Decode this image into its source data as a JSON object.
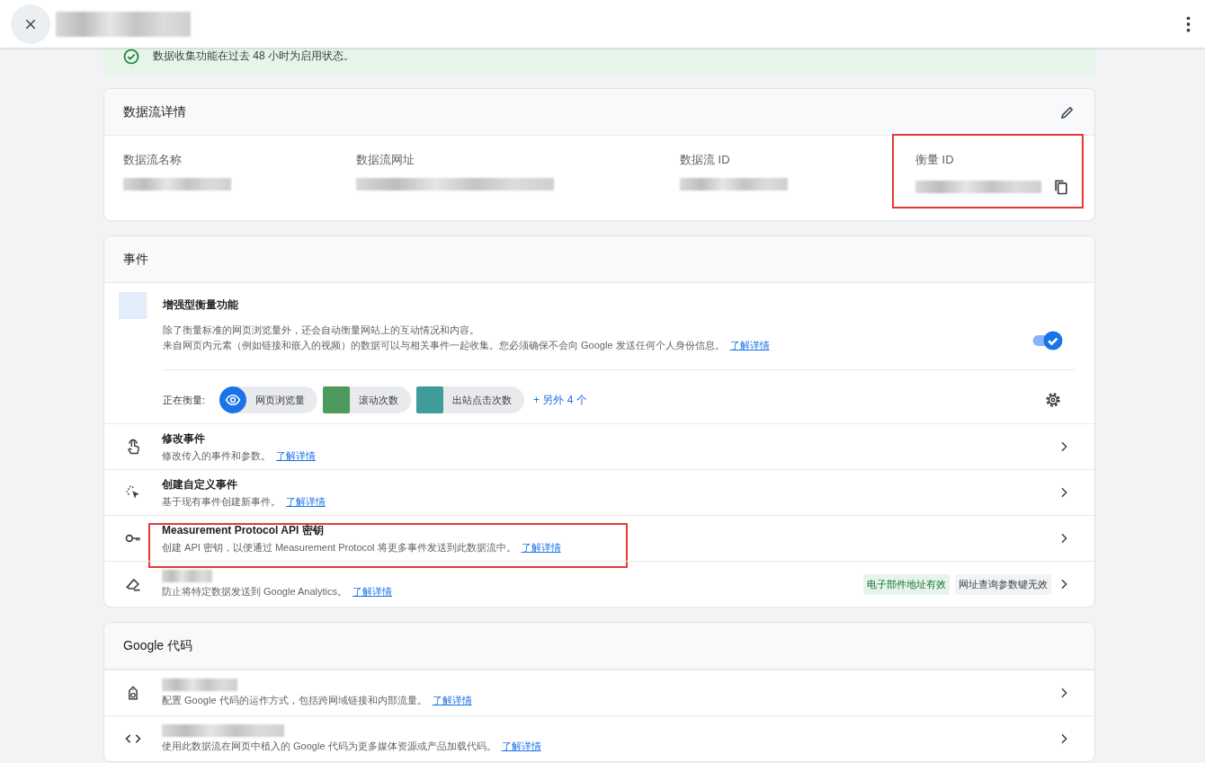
{
  "banner": {
    "text": "数据收集功能在过去 48 小时为启用状态。"
  },
  "stream_details": {
    "title": "数据流详情",
    "fields": [
      {
        "label": "数据流名称",
        "highlighted": false,
        "copyable": false
      },
      {
        "label": "数据流网址",
        "highlighted": false,
        "copyable": false
      },
      {
        "label": "数据流 ID",
        "highlighted": false,
        "copyable": false
      },
      {
        "label": "衡量 ID",
        "highlighted": true,
        "copyable": true
      }
    ]
  },
  "events": {
    "title": "事件",
    "enhanced": {
      "title": "增强型衡量功能",
      "line_1": "除了衡量标准的网页浏览量外，还会自动衡量网站上的互动情况和内容。",
      "line_2": "来自网页内元素（例如链接和嵌入的视频）的数据可以与相关事件一起收集。您必须确保不会向 Google 发送任何个人身份信息。",
      "link": "了解详情",
      "on": true,
      "measuring_label": "正在衡量:",
      "chips": [
        {
          "label": "网页浏览量",
          "kind": "eye",
          "color": "#1a73e8"
        },
        {
          "label": "滚动次数",
          "kind": "thumb",
          "color": "#4e9a5e"
        },
        {
          "label": "出站点击次数",
          "kind": "thumb",
          "color": "#3f9c9a"
        }
      ],
      "more": "+ 另外 4 个"
    },
    "rows": [
      {
        "kind": "touch",
        "title": "修改事件",
        "description": "修改传入的事件和参数。",
        "link": "了解详情",
        "highlighted": false,
        "tags": []
      },
      {
        "kind": "cursor",
        "title": "创建自定义事件",
        "description": "基于现有事件创建新事件。",
        "link": "了解详情",
        "highlighted": false,
        "tags": []
      },
      {
        "kind": "key",
        "title": "Measurement Protocol API 密钥",
        "description": "创建 API 密钥，以便通过 Measurement Protocol 将更多事件发送到此数据流中。",
        "link": "了解详情",
        "highlighted": true,
        "tags": []
      },
      {
        "kind": "eraser",
        "description": "防止将特定数据发送到 Google Analytics。",
        "link": "了解详情",
        "highlighted": false,
        "tags": [
          {
            "label": "电子部件地址有效",
            "color": "#e6f4ea"
          },
          {
            "label": "网址查询参数键无效",
            "color": "#f1f3f4"
          }
        ]
      }
    ]
  },
  "google_tag": {
    "title": "Google 代码",
    "rows": [
      {
        "kind": "tag",
        "description": "配置 Google 代码的运作方式，包括跨网域链接和内部流量。",
        "link": "了解详情"
      },
      {
        "kind": "code",
        "description": "使用此数据流在网页中植入的 Google 代码为更多媒体资源或产品加载代码。",
        "link": "了解详情"
      }
    ]
  }
}
